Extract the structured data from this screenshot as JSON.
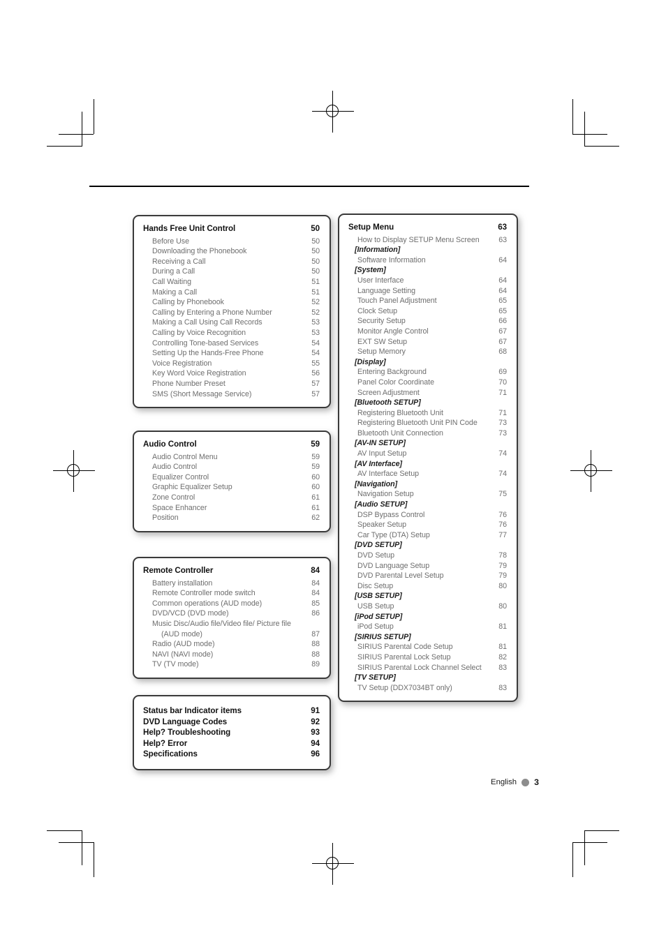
{
  "page": {
    "footer_language": "English",
    "footer_page_number": "3",
    "marks": {
      "registration_icon": "registration-crosshair-icon",
      "crop_icon": "crop-mark-icon"
    }
  },
  "boxes": {
    "hands_free": {
      "heading": {
        "label": "Hands Free Unit Control",
        "page": "50"
      },
      "items": [
        {
          "label": "Before Use",
          "page": "50"
        },
        {
          "label": "Downloading the Phonebook",
          "page": "50"
        },
        {
          "label": "Receiving a Call",
          "page": "50"
        },
        {
          "label": "During a Call",
          "page": "50"
        },
        {
          "label": "Call Waiting",
          "page": "51"
        },
        {
          "label": "Making a Call",
          "page": "51"
        },
        {
          "label": "Calling by Phonebook",
          "page": "52"
        },
        {
          "label": "Calling by Entering a Phone Number",
          "page": "52"
        },
        {
          "label": "Making a Call Using Call Records",
          "page": "53"
        },
        {
          "label": "Calling by Voice Recognition",
          "page": "53"
        },
        {
          "label": "Controlling Tone-based Services",
          "page": "54"
        },
        {
          "label": "Setting Up the Hands-Free Phone",
          "page": "54"
        },
        {
          "label": "Voice Registration",
          "page": "55"
        },
        {
          "label": "Key Word Voice Registration",
          "page": "56"
        },
        {
          "label": "Phone Number Preset",
          "page": "57"
        },
        {
          "label": "SMS (Short Message Service)",
          "page": "57"
        }
      ]
    },
    "audio_control": {
      "heading": {
        "label": "Audio Control",
        "page": "59"
      },
      "items": [
        {
          "label": "Audio Control Menu",
          "page": "59"
        },
        {
          "label": "Audio Control",
          "page": "59"
        },
        {
          "label": "Equalizer Control",
          "page": "60"
        },
        {
          "label": "Graphic Equalizer Setup",
          "page": "60"
        },
        {
          "label": "Zone Control",
          "page": "61"
        },
        {
          "label": "Space Enhancer",
          "page": "61"
        },
        {
          "label": "Position",
          "page": "62"
        }
      ]
    },
    "remote_controller": {
      "heading": {
        "label": "Remote Controller",
        "page": "84"
      },
      "items": [
        {
          "label": "Battery installation",
          "page": "84"
        },
        {
          "label": "Remote Controller mode switch",
          "page": "84"
        },
        {
          "label": "Common operations (AUD mode)",
          "page": "85"
        },
        {
          "label": "DVD/VCD (DVD mode)",
          "page": "86"
        },
        {
          "label": "Music Disc/Audio file/Video file/ Picture file",
          "page": ""
        },
        {
          "label": "(AUD mode)",
          "page": "87",
          "continuation": true
        },
        {
          "label": "Radio (AUD mode)",
          "page": "88"
        },
        {
          "label": "NAVI (NAVI mode)",
          "page": "88"
        },
        {
          "label": "TV (TV mode)",
          "page": "89"
        }
      ]
    },
    "misc": {
      "items": [
        {
          "label": "Status bar Indicator items",
          "page": "91"
        },
        {
          "label": "DVD Language Codes",
          "page": "92"
        },
        {
          "label": "Help? Troubleshooting",
          "page": "93"
        },
        {
          "label": "Help? Error",
          "page": "94"
        },
        {
          "label": "Specifications",
          "page": "96"
        }
      ]
    },
    "setup_menu": {
      "heading": {
        "label": "Setup Menu",
        "page": "63"
      },
      "items": [
        {
          "type": "item",
          "label": "How to Display SETUP Menu Screen",
          "page": "63"
        },
        {
          "type": "cat",
          "label": "[Information]",
          "page": ""
        },
        {
          "type": "item",
          "label": "Software Information",
          "page": "64"
        },
        {
          "type": "cat",
          "label": "[System]",
          "page": ""
        },
        {
          "type": "item",
          "label": "User Interface",
          "page": "64"
        },
        {
          "type": "item",
          "label": "Language Setting",
          "page": "64"
        },
        {
          "type": "item",
          "label": "Touch Panel Adjustment",
          "page": "65"
        },
        {
          "type": "item",
          "label": "Clock Setup",
          "page": "65"
        },
        {
          "type": "item",
          "label": "Security Setup",
          "page": "66"
        },
        {
          "type": "item",
          "label": "Monitor Angle Control",
          "page": "67"
        },
        {
          "type": "item",
          "label": "EXT SW Setup",
          "page": "67"
        },
        {
          "type": "item",
          "label": "Setup Memory",
          "page": "68"
        },
        {
          "type": "cat",
          "label": "[Display]",
          "page": ""
        },
        {
          "type": "item",
          "label": "Entering Background",
          "page": "69"
        },
        {
          "type": "item",
          "label": "Panel Color Coordinate",
          "page": "70"
        },
        {
          "type": "item",
          "label": "Screen Adjustment",
          "page": "71"
        },
        {
          "type": "cat",
          "label": "[Bluetooth SETUP]",
          "page": ""
        },
        {
          "type": "item",
          "label": "Registering Bluetooth Unit",
          "page": "71"
        },
        {
          "type": "item",
          "label": "Registering Bluetooth Unit PIN Code",
          "page": "73"
        },
        {
          "type": "item",
          "label": "Bluetooth Unit Connection",
          "page": "73"
        },
        {
          "type": "cat",
          "label": "[AV-IN SETUP]",
          "page": ""
        },
        {
          "type": "item",
          "label": "AV Input Setup",
          "page": "74"
        },
        {
          "type": "cat",
          "label": "[AV Interface]",
          "page": ""
        },
        {
          "type": "item",
          "label": "AV Interface Setup",
          "page": "74"
        },
        {
          "type": "cat",
          "label": "[Navigation]",
          "page": ""
        },
        {
          "type": "item",
          "label": "Navigation Setup",
          "page": "75"
        },
        {
          "type": "cat",
          "label": "[Audio SETUP]",
          "page": ""
        },
        {
          "type": "item",
          "label": "DSP Bypass Control",
          "page": "76"
        },
        {
          "type": "item",
          "label": "Speaker Setup",
          "page": "76"
        },
        {
          "type": "item",
          "label": "Car Type (DTA) Setup",
          "page": "77"
        },
        {
          "type": "cat",
          "label": "[DVD SETUP]",
          "page": ""
        },
        {
          "type": "item",
          "label": "DVD Setup",
          "page": "78"
        },
        {
          "type": "item",
          "label": "DVD Language Setup",
          "page": "79"
        },
        {
          "type": "item",
          "label": "DVD Parental Level Setup",
          "page": "79"
        },
        {
          "type": "item",
          "label": "Disc Setup",
          "page": "80"
        },
        {
          "type": "cat",
          "label": "[USB SETUP]",
          "page": ""
        },
        {
          "type": "item",
          "label": "USB Setup",
          "page": "80"
        },
        {
          "type": "cat",
          "label": "[iPod SETUP]",
          "page": ""
        },
        {
          "type": "item",
          "label": "iPod Setup",
          "page": "81"
        },
        {
          "type": "cat",
          "label": "[SIRIUS SETUP]",
          "page": ""
        },
        {
          "type": "item",
          "label": "SIRIUS Parental Code Setup",
          "page": "81"
        },
        {
          "type": "item",
          "label": "SIRIUS Parental Lock Setup",
          "page": "82"
        },
        {
          "type": "item",
          "label": "SIRIUS Parental Lock Channel Select",
          "page": "83"
        },
        {
          "type": "cat",
          "label": "[TV SETUP]",
          "page": ""
        },
        {
          "type": "item",
          "label": "TV Setup (DDX7034BT only)",
          "page": "83"
        }
      ]
    }
  }
}
